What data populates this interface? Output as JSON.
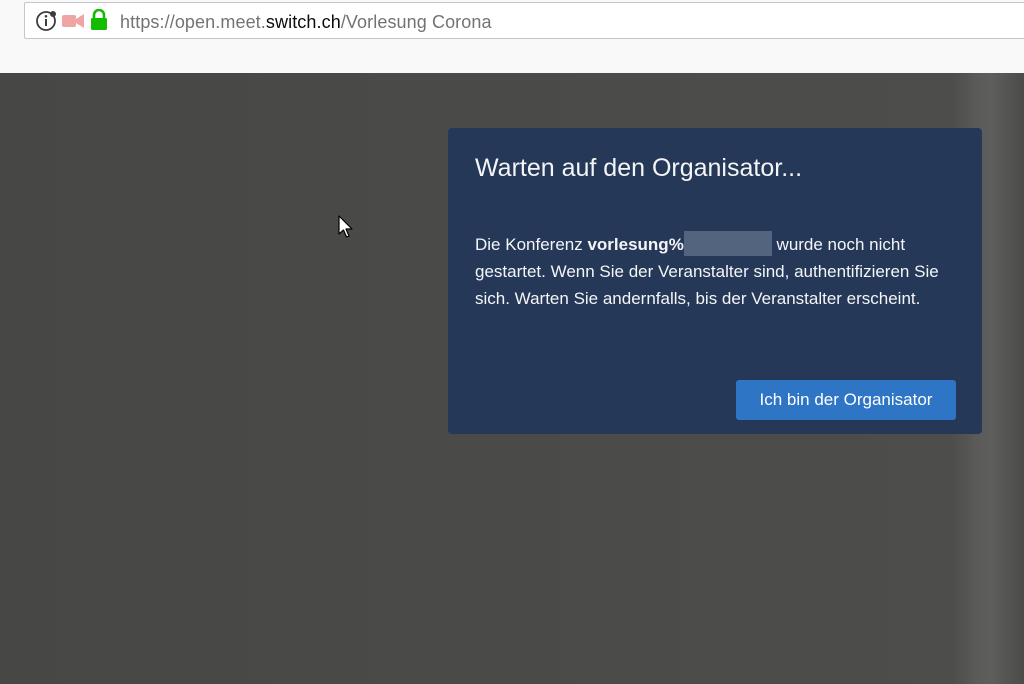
{
  "browser": {
    "url_prefix": "https://open.meet.",
    "url_host": "switch.ch",
    "url_path": "/Vorlesung Corona",
    "icons": [
      "info-icon",
      "camera-blocked-icon",
      "lock-icon"
    ],
    "lock_color": "#12bc00",
    "camera_color": "#f0a5a5"
  },
  "dialog": {
    "title": "Warten auf den Organisator...",
    "body_before": "Die Konferenz ",
    "room_name": "vorlesung%",
    "body_after": " wurde noch nicht gestartet. Wenn Sie der Veranstalter sind, authentifizieren Sie sich. Warten Sie andernfalls, bis der Veranstalter erscheint.",
    "button_label": "Ich bin der Organisator",
    "colors": {
      "background": "#253858",
      "button": "#2f75c6",
      "text": "#f4f5f7"
    }
  },
  "meeting": {
    "background_color": "#4a4a48"
  }
}
